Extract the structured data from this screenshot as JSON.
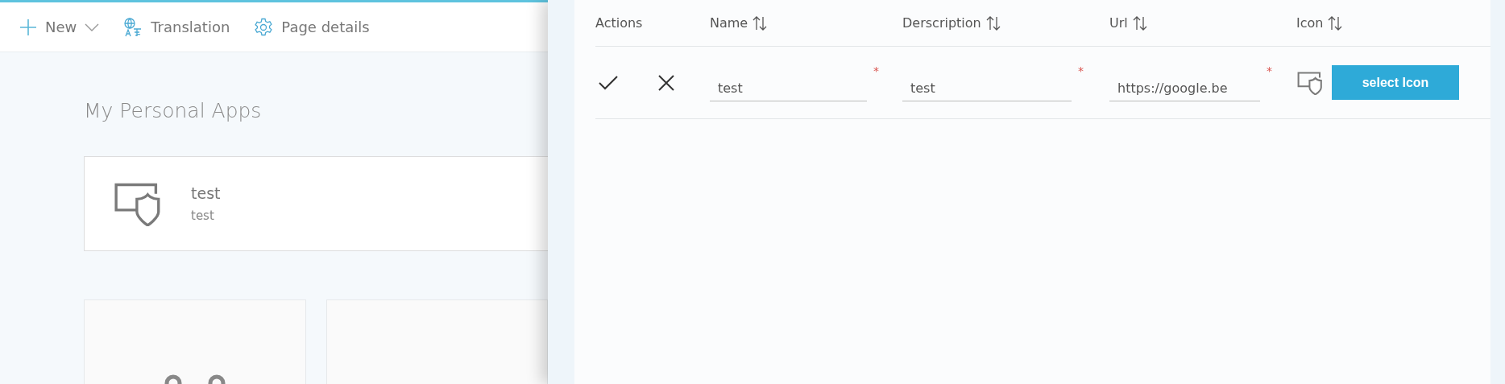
{
  "toolbar": {
    "items": [
      {
        "kind": "new",
        "label": "New"
      },
      {
        "kind": "translation",
        "label": "Translation"
      },
      {
        "kind": "settings",
        "label": "Page details"
      }
    ]
  },
  "page": {
    "title": "My Personal Apps",
    "apps": [
      {
        "title": "test",
        "description": "test"
      }
    ],
    "tiles": [
      {
        "kind": "people"
      },
      {
        "kind": "blank"
      }
    ]
  },
  "panel": {
    "columns": [
      {
        "label": "Actions",
        "sortable": false
      },
      {
        "label": "Name",
        "sortable": true
      },
      {
        "label": "Derscription",
        "sortable": true
      },
      {
        "label": "Url",
        "sortable": true
      },
      {
        "label": "Icon",
        "sortable": true
      }
    ],
    "rows": [
      {
        "fields": [
          {
            "value": "test",
            "required_mark": "*"
          },
          {
            "value": "test",
            "required_mark": "*"
          },
          {
            "value": "https://google.be",
            "required_mark": "*"
          }
        ],
        "button": "select Icon"
      }
    ]
  }
}
